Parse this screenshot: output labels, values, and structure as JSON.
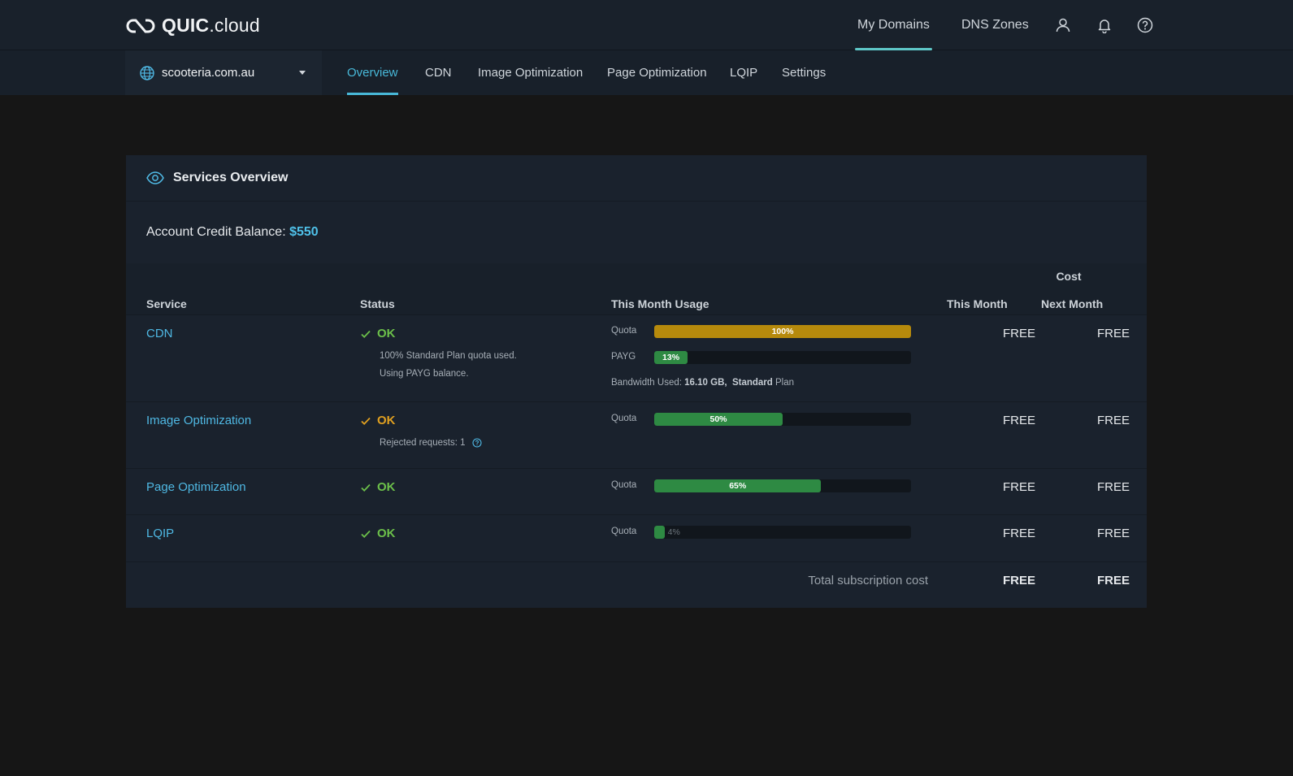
{
  "header": {
    "logo_bold": "QUIC",
    "logo_rest": ".cloud",
    "nav": [
      {
        "label": "My Domains"
      },
      {
        "label": "DNS Zones"
      }
    ]
  },
  "subbar": {
    "domain": "scooteria.com.au",
    "tabs": [
      {
        "label": "Overview"
      },
      {
        "label": "CDN"
      },
      {
        "label": "Image Optimization"
      },
      {
        "label": "Page Optimization"
      },
      {
        "label": "LQIP"
      },
      {
        "label": "Settings"
      }
    ]
  },
  "overview": {
    "title": "Services Overview",
    "credit_label": "Account Credit Balance:",
    "credit_value": "$550",
    "columns": {
      "service": "Service",
      "status": "Status",
      "usage": "This Month Usage",
      "cost": "Cost",
      "this_month": "This Month",
      "next_month": "Next Month"
    },
    "rows": [
      {
        "service": "CDN",
        "status": "OK",
        "notes": [
          "100% Standard Plan quota used.",
          "Using PAYG balance."
        ],
        "bars": [
          {
            "label": "Quota",
            "percent": 100,
            "text": "100%"
          },
          {
            "label": "PAYG",
            "percent": 13,
            "text": "13%"
          }
        ],
        "bandwidth_prefix": "Bandwidth Used:",
        "bandwidth_value": "16.10 GB,",
        "plan_name": "Standard",
        "plan_suffix": "Plan",
        "this_month": "FREE",
        "next_month": "FREE"
      },
      {
        "service": "Image Optimization",
        "status": "OK",
        "notes": [
          "Rejected requests: 1"
        ],
        "bars": [
          {
            "label": "Quota",
            "percent": 50,
            "text": "50%"
          }
        ],
        "this_month": "FREE",
        "next_month": "FREE"
      },
      {
        "service": "Page Optimization",
        "status": "OK",
        "bars": [
          {
            "label": "Quota",
            "percent": 65,
            "text": "65%"
          }
        ],
        "this_month": "FREE",
        "next_month": "FREE"
      },
      {
        "service": "LQIP",
        "status": "OK",
        "bars": [
          {
            "label": "Quota",
            "percent": 4,
            "text": "4%"
          }
        ],
        "this_month": "FREE",
        "next_month": "FREE"
      }
    ],
    "total_label": "Total subscription cost",
    "total_this_month": "FREE",
    "total_next_month": "FREE"
  },
  "colors": {
    "accent": "#48b8d8",
    "ok_green": "#6cc04a",
    "ok_orange": "#e0a020",
    "bar_gold": "#b68a0c",
    "bar_green": "#2e8a43"
  }
}
